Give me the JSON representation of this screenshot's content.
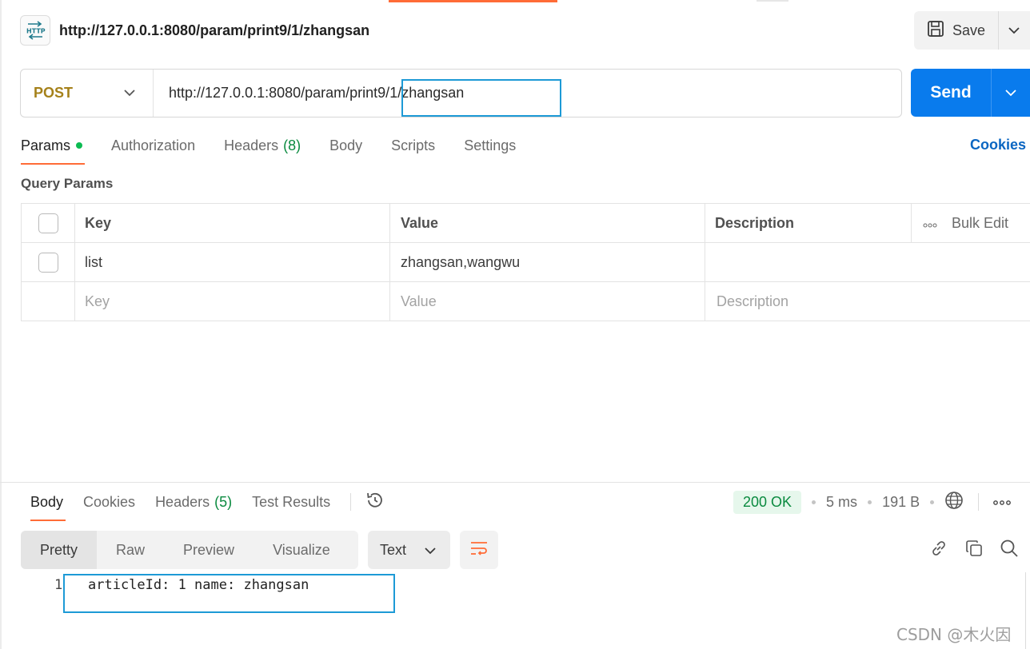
{
  "header": {
    "request_title": "http://127.0.0.1:8080/param/print9/1/zhangsan",
    "badge_icon": "http-icon",
    "save_label": "Save"
  },
  "url_bar": {
    "method": "POST",
    "url": "http://127.0.0.1:8080/param/print9/1/zhangsan",
    "send_label": "Send"
  },
  "request_tabs": [
    {
      "label": "Params",
      "active": true,
      "indicator": true
    },
    {
      "label": "Authorization"
    },
    {
      "label": "Headers",
      "count": "(8)"
    },
    {
      "label": "Body"
    },
    {
      "label": "Scripts"
    },
    {
      "label": "Settings"
    }
  ],
  "cookies_link": "Cookies",
  "query_params": {
    "title": "Query Params",
    "headers": {
      "key": "Key",
      "value": "Value",
      "description": "Description",
      "bulk_edit": "Bulk Edit"
    },
    "rows": [
      {
        "key": "list",
        "value": "zhangsan,wangwu",
        "description": ""
      }
    ],
    "placeholders": {
      "key": "Key",
      "value": "Value",
      "description": "Description"
    }
  },
  "response": {
    "tabs": [
      {
        "label": "Body",
        "active": true
      },
      {
        "label": "Cookies"
      },
      {
        "label": "Headers",
        "count": "(5)"
      },
      {
        "label": "Test Results"
      }
    ],
    "status": "200 OK",
    "time": "5 ms",
    "size": "191 B",
    "views": [
      "Pretty",
      "Raw",
      "Preview",
      "Visualize"
    ],
    "active_view": "Pretty",
    "format": "Text",
    "body_lines": [
      {
        "no": "1",
        "text": "articleId: 1 name: zhangsan"
      }
    ]
  },
  "watermark": "CSDN @木火因",
  "colors": {
    "accent": "#ff6c37",
    "send": "#097bed",
    "method": "#a5811a",
    "status_ok": "#0a8a3f",
    "highlight": "#1d9ad6"
  }
}
